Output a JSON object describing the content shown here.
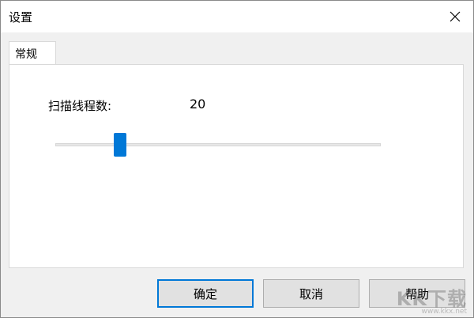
{
  "window": {
    "title": "设置"
  },
  "tabs": [
    {
      "label": "常规"
    }
  ],
  "general": {
    "thread_label": "扫描线程数:",
    "thread_count": "20",
    "slider": {
      "value": 20,
      "min": 0,
      "max": 100,
      "fraction": 0.2
    }
  },
  "buttons": {
    "ok": "确定",
    "cancel": "取消",
    "help": "帮助"
  },
  "watermark": {
    "main": "KK下载",
    "url": "www.kkx.net"
  },
  "colors": {
    "accent": "#0078d7",
    "face": "#f0f0f0",
    "button": "#e1e1e1"
  }
}
